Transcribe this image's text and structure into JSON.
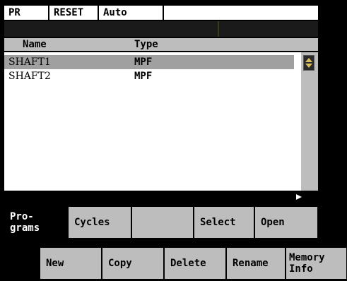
{
  "status": {
    "channel": "PR",
    "state": "RESET",
    "mode": "Auto",
    "program": "",
    "message": ""
  },
  "table": {
    "headers": {
      "name": "Name",
      "type": "Type"
    },
    "rows": [
      {
        "name": "SHAFT1",
        "type": "MPF"
      },
      {
        "name": "SHAFT2",
        "type": "MPF"
      }
    ]
  },
  "vertical_softkeys": [
    {
      "label": "Pro-\ngrams"
    },
    {
      "label": "Cycles"
    },
    {
      "label": ""
    },
    {
      "label": "Select"
    },
    {
      "label": "Open"
    }
  ],
  "horizontal_softkeys": [
    {
      "label": "New"
    },
    {
      "label": "Copy"
    },
    {
      "label": "Delete"
    },
    {
      "label": "Rename"
    },
    {
      "label": "Memory\nInfo"
    }
  ],
  "colors": {
    "panel_gray": "#bdbdbd",
    "selection": "#a0a0a0",
    "background": "#000000"
  }
}
